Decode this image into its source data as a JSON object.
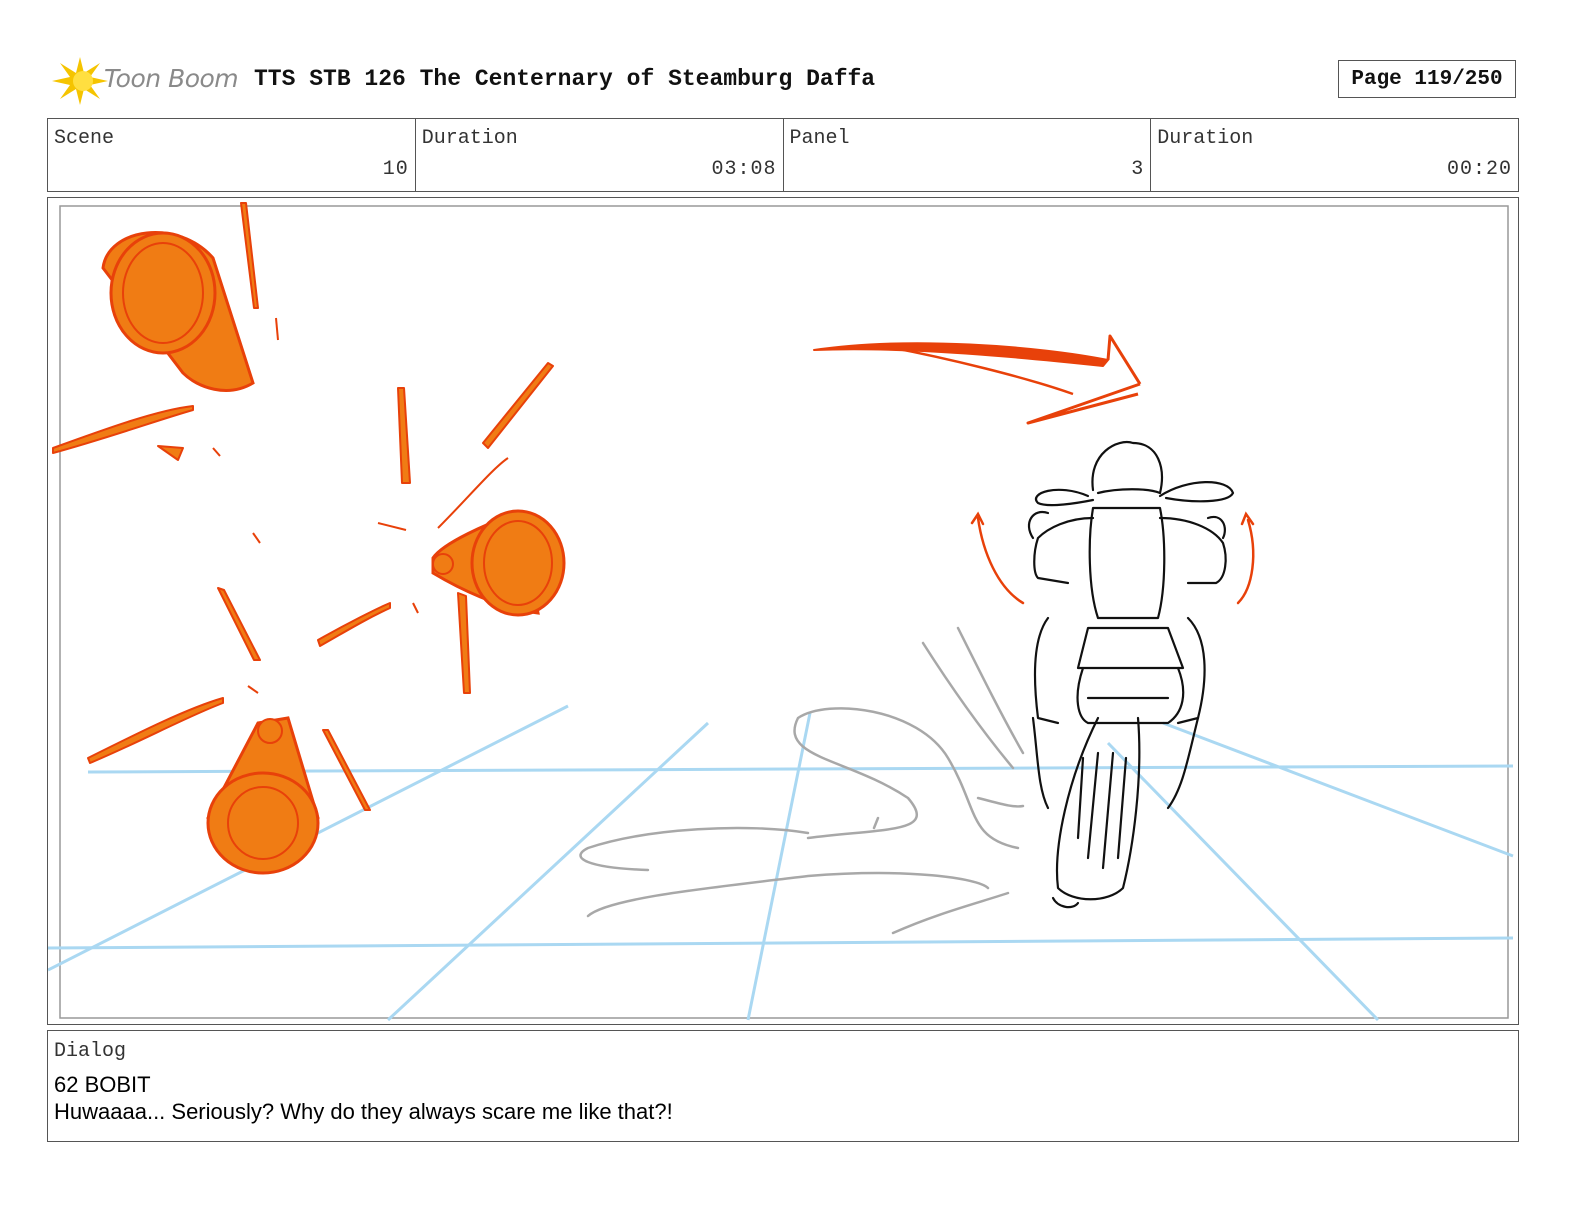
{
  "header": {
    "logo_text": "Toon Boom",
    "title": "TTS STB 126 The Centernary of Steamburg Daffa",
    "page_label": "Page 119/250"
  },
  "info": {
    "scene_label": "Scene",
    "scene_value": "10",
    "scene_duration_label": "Duration",
    "scene_duration_value": "03:08",
    "panel_label": "Panel",
    "panel_value": "3",
    "panel_duration_label": "Duration",
    "panel_duration_value": "00:20"
  },
  "dialog": {
    "label": "Dialog",
    "speaker": "62 BOBIT",
    "line": "Huwaaaa... Seriously? Why do they always scare me like that?!"
  },
  "colors": {
    "cone_fill": "#f07c14",
    "cone_stroke": "#e8410a",
    "guide_blue": "#aad8f2",
    "sketch_gray": "#a8a8a8",
    "ink": "#111111",
    "logo_yellow": "#f5c400"
  }
}
